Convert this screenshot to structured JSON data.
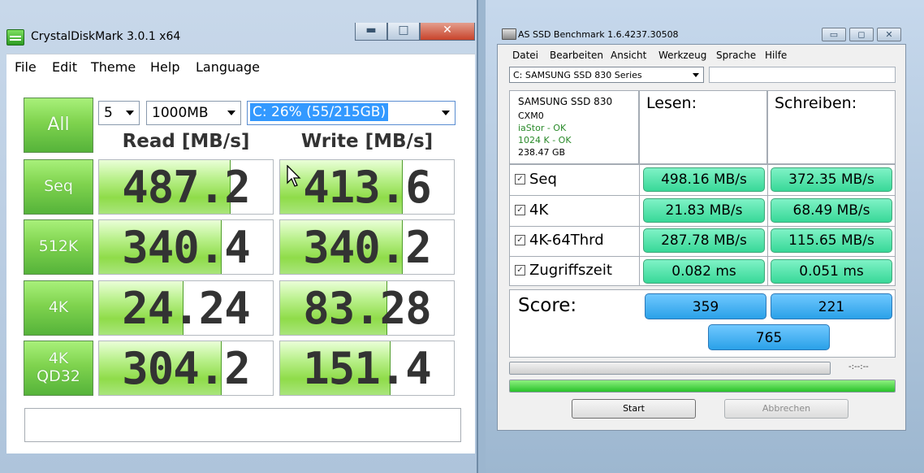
{
  "cdm": {
    "title": "CrystalDiskMark 3.0.1 x64",
    "window_buttons": {
      "minimize": "▬",
      "maximize": "□",
      "close": "✕"
    },
    "menu": [
      "File",
      "Edit",
      "Theme",
      "Help",
      "Language"
    ],
    "all_button": "All",
    "test_count": "5",
    "test_size": "1000MB",
    "drive": "C: 26% (55/215GB)",
    "read_header": "Read [MB/s]",
    "write_header": "Write [MB/s]",
    "rows": [
      {
        "label": "Seq",
        "read": "487.2",
        "write": "413.6",
        "read_fill": 0.75,
        "write_fill": 0.7
      },
      {
        "label": "512K",
        "read": "340.4",
        "write": "340.2",
        "read_fill": 0.7,
        "write_fill": 0.7
      },
      {
        "label": "4K",
        "read": "24.24",
        "write": "83.28",
        "read_fill": 0.48,
        "write_fill": 0.61
      },
      {
        "label": "4K\nQD32",
        "read": "304.2",
        "write": "151.4",
        "read_fill": 0.7,
        "write_fill": 0.63
      }
    ],
    "colors": {
      "accent": "#7fd34e"
    }
  },
  "asssd": {
    "title": "AS SSD Benchmark 1.6.4237.30508",
    "window_buttons": {
      "minimize": "▭",
      "maximize": "◻",
      "close": "✕"
    },
    "menu": [
      "Datei",
      "Bearbeiten",
      "Ansicht",
      "Werkzeug",
      "Sprache",
      "Hilfe"
    ],
    "drive_select": "C: SAMSUNG SSD 830 Series",
    "info": [
      "SAMSUNG SSD 830",
      "CXM0",
      "iaStor - OK",
      "1024 K - OK",
      "238.47 GB"
    ],
    "read_header": "Lesen:",
    "write_header": "Schreiben:",
    "rows": [
      {
        "label": "Seq",
        "checked": "✓",
        "read": "498.16 MB/s",
        "write": "372.35 MB/s"
      },
      {
        "label": "4K",
        "checked": "✓",
        "read": "21.83 MB/s",
        "write": "68.49 MB/s"
      },
      {
        "label": "4K-64Thrd",
        "checked": "✓",
        "read": "287.78 MB/s",
        "write": "115.65 MB/s"
      },
      {
        "label": "Zugriffszeit",
        "checked": "✓",
        "read": "0.082 ms",
        "write": "0.051 ms"
      }
    ],
    "score_label": "Score:",
    "score_read": "359",
    "score_write": "221",
    "score_total": "765",
    "time_display": "-:--:--",
    "progress_total": 1.0,
    "start_button": "Start",
    "abort_button": "Abbrechen",
    "colors": {
      "result_box": "#38d898",
      "score_box": "#2aa1e8",
      "progress": "#3cc83c"
    }
  }
}
